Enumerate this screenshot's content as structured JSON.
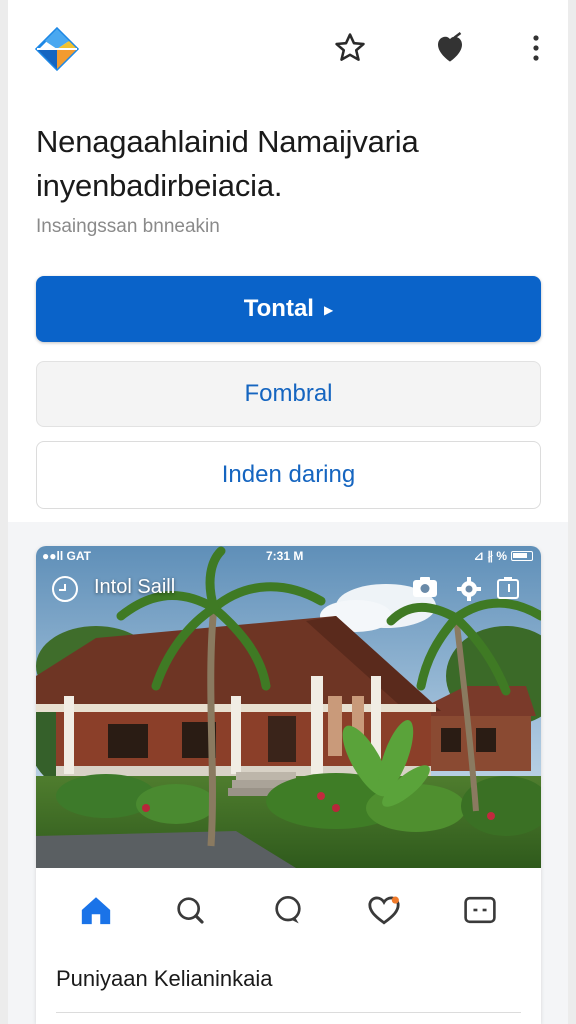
{
  "header": {
    "logo_icon": "diamond-logo-icon",
    "actions": [
      {
        "icon": "star-icon",
        "label": "star"
      },
      {
        "icon": "heart-icon",
        "label": "favorite"
      },
      {
        "icon": "more-vertical-icon",
        "label": "more"
      }
    ]
  },
  "hero": {
    "headline": "Nenagaahlainid Namaijvaria inyenbadirbeiacia.",
    "subtitle": "Insaingssan bnneakin"
  },
  "buttons": {
    "primary_label": "Tontal",
    "secondary_label": "Fombral",
    "outline_label": "Inden daring"
  },
  "photo_card": {
    "status": {
      "left": "●●ll GAT",
      "time": "7:31 M",
      "right": "⊿ ∦ %"
    },
    "overlay_title": "Intol Saill",
    "overlay_icons": [
      "camera-icon",
      "settings-icon",
      "share-icon"
    ],
    "tabs": [
      {
        "icon": "home-icon",
        "active": true
      },
      {
        "icon": "search-icon",
        "active": false
      },
      {
        "icon": "chat-icon",
        "active": false
      },
      {
        "icon": "heart-icon",
        "active": false
      },
      {
        "icon": "message-box-icon",
        "active": false
      }
    ],
    "title": "Puniyaan Kelianinkaia"
  },
  "colors": {
    "primary": "#0a63c9",
    "link": "#1565c0",
    "active_tab": "#1a73e8",
    "logo_blue": "#1e88e5",
    "logo_orange": "#f29b30"
  }
}
